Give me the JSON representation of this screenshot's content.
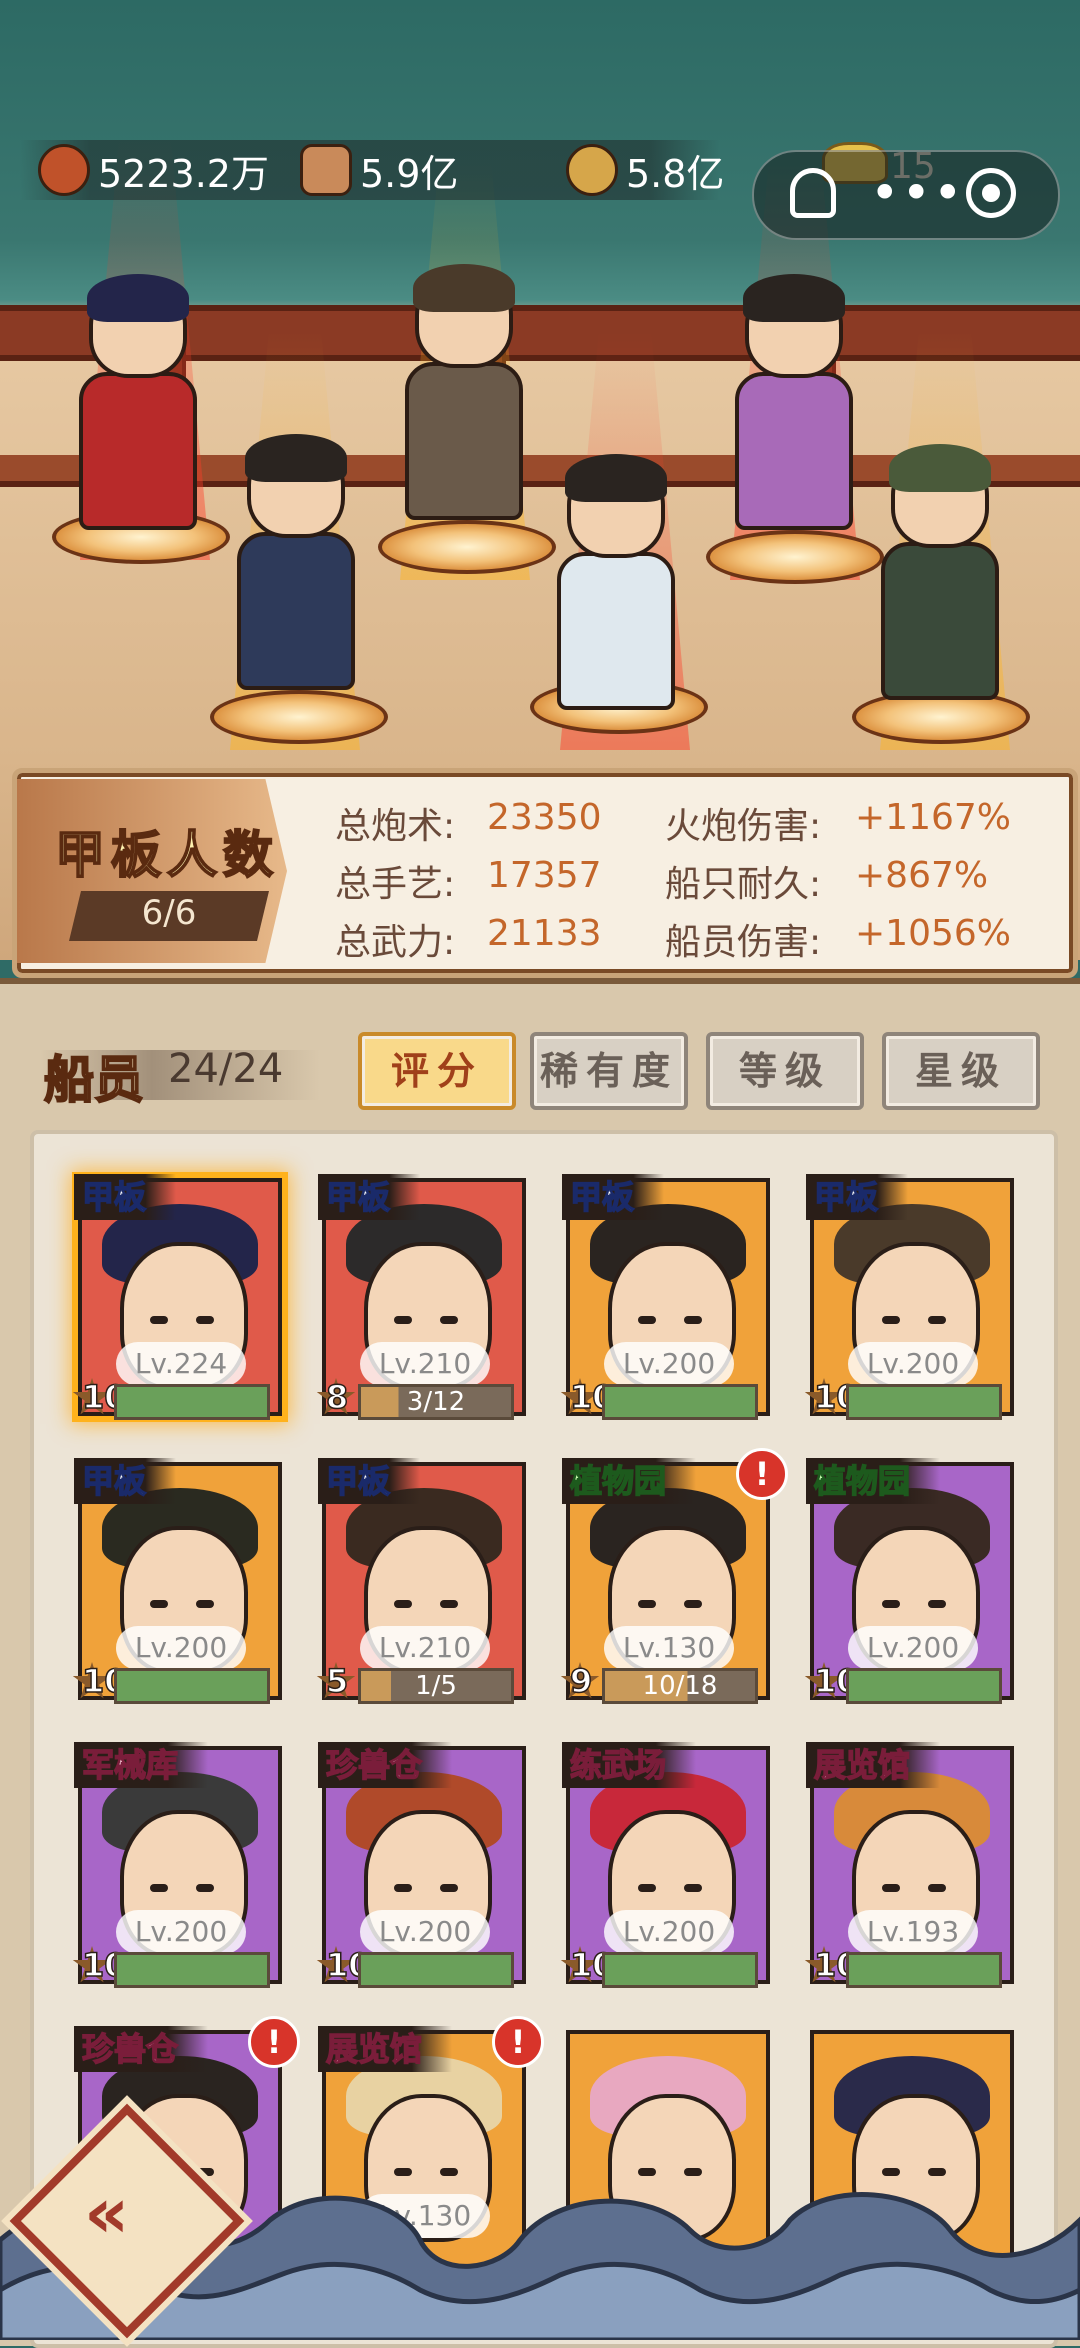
{
  "resources": [
    {
      "name": "meat-icon",
      "value": "5223.2万",
      "color": "#c0522a"
    },
    {
      "name": "wood-icon",
      "value": "5.9亿",
      "color": "#c98a5a"
    },
    {
      "name": "coin-icon",
      "value": "5.8亿",
      "color": "#d6a64a"
    },
    {
      "name": "gold-ingot-icon",
      "value": "15",
      "color": "#e8c24a"
    }
  ],
  "deck": {
    "title": "甲板人数",
    "count": "6/6",
    "stats": [
      {
        "label": "总炮术:",
        "value": "23350"
      },
      {
        "label": "总手艺:",
        "value": "17357"
      },
      {
        "label": "总武力:",
        "value": "21133"
      }
    ],
    "bonuses": [
      {
        "label": "火炮伤害:",
        "value": "+1167%"
      },
      {
        "label": "船只耐久:",
        "value": "+867%"
      },
      {
        "label": "船员伤害:",
        "value": "+1056%"
      }
    ]
  },
  "crew": {
    "label": "船员",
    "count": "24/24",
    "sorts": [
      "评分",
      "稀有度",
      "等级",
      "星级"
    ],
    "active_sort": "评分",
    "cards": [
      {
        "loc": "甲板",
        "lv": "Lv.224",
        "star": "10",
        "bg": "#e05a4a",
        "hair": "#23254a",
        "progress": 1.0,
        "bar_text": "",
        "selected": true,
        "alert": false,
        "loc_style": ""
      },
      {
        "loc": "甲板",
        "lv": "Lv.210",
        "star": "8",
        "bg": "#e05a4a",
        "hair": "#2c2a2a",
        "progress": 0.25,
        "bar_text": "3/12",
        "selected": false,
        "alert": false,
        "loc_style": ""
      },
      {
        "loc": "甲板",
        "lv": "Lv.200",
        "star": "10",
        "bg": "#f0a23a",
        "hair": "#2a2420",
        "progress": 1.0,
        "bar_text": "",
        "selected": false,
        "alert": false,
        "loc_style": ""
      },
      {
        "loc": "甲板",
        "lv": "Lv.200",
        "star": "10",
        "bg": "#f0a23a",
        "hair": "#4a3a2a",
        "progress": 1.0,
        "bar_text": "",
        "selected": false,
        "alert": false,
        "loc_style": ""
      },
      {
        "loc": "甲板",
        "lv": "Lv.200",
        "star": "10",
        "bg": "#f0a23a",
        "hair": "#2a2a20",
        "progress": 1.0,
        "bar_text": "",
        "selected": false,
        "alert": false,
        "loc_style": ""
      },
      {
        "loc": "甲板",
        "lv": "Lv.210",
        "star": "5",
        "bg": "#e05a4a",
        "hair": "#3a2a20",
        "progress": 0.2,
        "bar_text": "1/5",
        "selected": false,
        "alert": false,
        "loc_style": ""
      },
      {
        "loc": "植物园",
        "lv": "Lv.130",
        "star": "9",
        "bg": "#f0a23a",
        "hair": "#2a2420",
        "progress": 0.55,
        "bar_text": "10/18",
        "selected": false,
        "alert": true,
        "loc_style": "green"
      },
      {
        "loc": "植物园",
        "lv": "Lv.200",
        "star": "10",
        "bg": "#a866c8",
        "hair": "#3a2a24",
        "progress": 1.0,
        "bar_text": "",
        "selected": false,
        "alert": false,
        "loc_style": "green"
      },
      {
        "loc": "军械库",
        "lv": "Lv.200",
        "star": "10",
        "bg": "#a866c8",
        "hair": "#3a3a3a",
        "progress": 1.0,
        "bar_text": "",
        "selected": false,
        "alert": false,
        "loc_style": "pink"
      },
      {
        "loc": "珍兽仓",
        "lv": "Lv.200",
        "star": "10",
        "bg": "#a866c8",
        "hair": "#b04a2a",
        "progress": 1.0,
        "bar_text": "",
        "selected": false,
        "alert": false,
        "loc_style": "pink"
      },
      {
        "loc": "练武场",
        "lv": "Lv.200",
        "star": "10",
        "bg": "#a866c8",
        "hair": "#c8283a",
        "progress": 1.0,
        "bar_text": "",
        "selected": false,
        "alert": false,
        "loc_style": "pink"
      },
      {
        "loc": "展览馆",
        "lv": "Lv.193",
        "star": "10",
        "bg": "#a866c8",
        "hair": "#d88a3a",
        "progress": 1.0,
        "bar_text": "",
        "selected": false,
        "alert": false,
        "loc_style": "pink"
      },
      {
        "loc": "珍兽仓",
        "lv": "",
        "star": "",
        "bg": "#a866c8",
        "hair": "#2a2420",
        "progress": null,
        "bar_text": "",
        "selected": false,
        "alert": true,
        "loc_style": "pink"
      },
      {
        "loc": "展览馆",
        "lv": "Lv.130",
        "star": "",
        "bg": "#f0a23a",
        "hair": "#e8d2a2",
        "progress": null,
        "bar_text": "",
        "selected": false,
        "alert": true,
        "loc_style": "pink"
      },
      {
        "loc": "",
        "lv": "",
        "star": "",
        "bg": "#f0a23a",
        "hair": "#e8a8c0",
        "progress": null,
        "bar_text": "",
        "selected": false,
        "alert": false,
        "loc_style": ""
      },
      {
        "loc": "",
        "lv": "",
        "star": "",
        "bg": "#f0a23a",
        "hair": "#2a2a4a",
        "progress": null,
        "bar_text": "",
        "selected": false,
        "alert": false,
        "loc_style": ""
      }
    ]
  },
  "colors": {
    "accent": "#c4662a",
    "wave": "#5a6e8c"
  }
}
